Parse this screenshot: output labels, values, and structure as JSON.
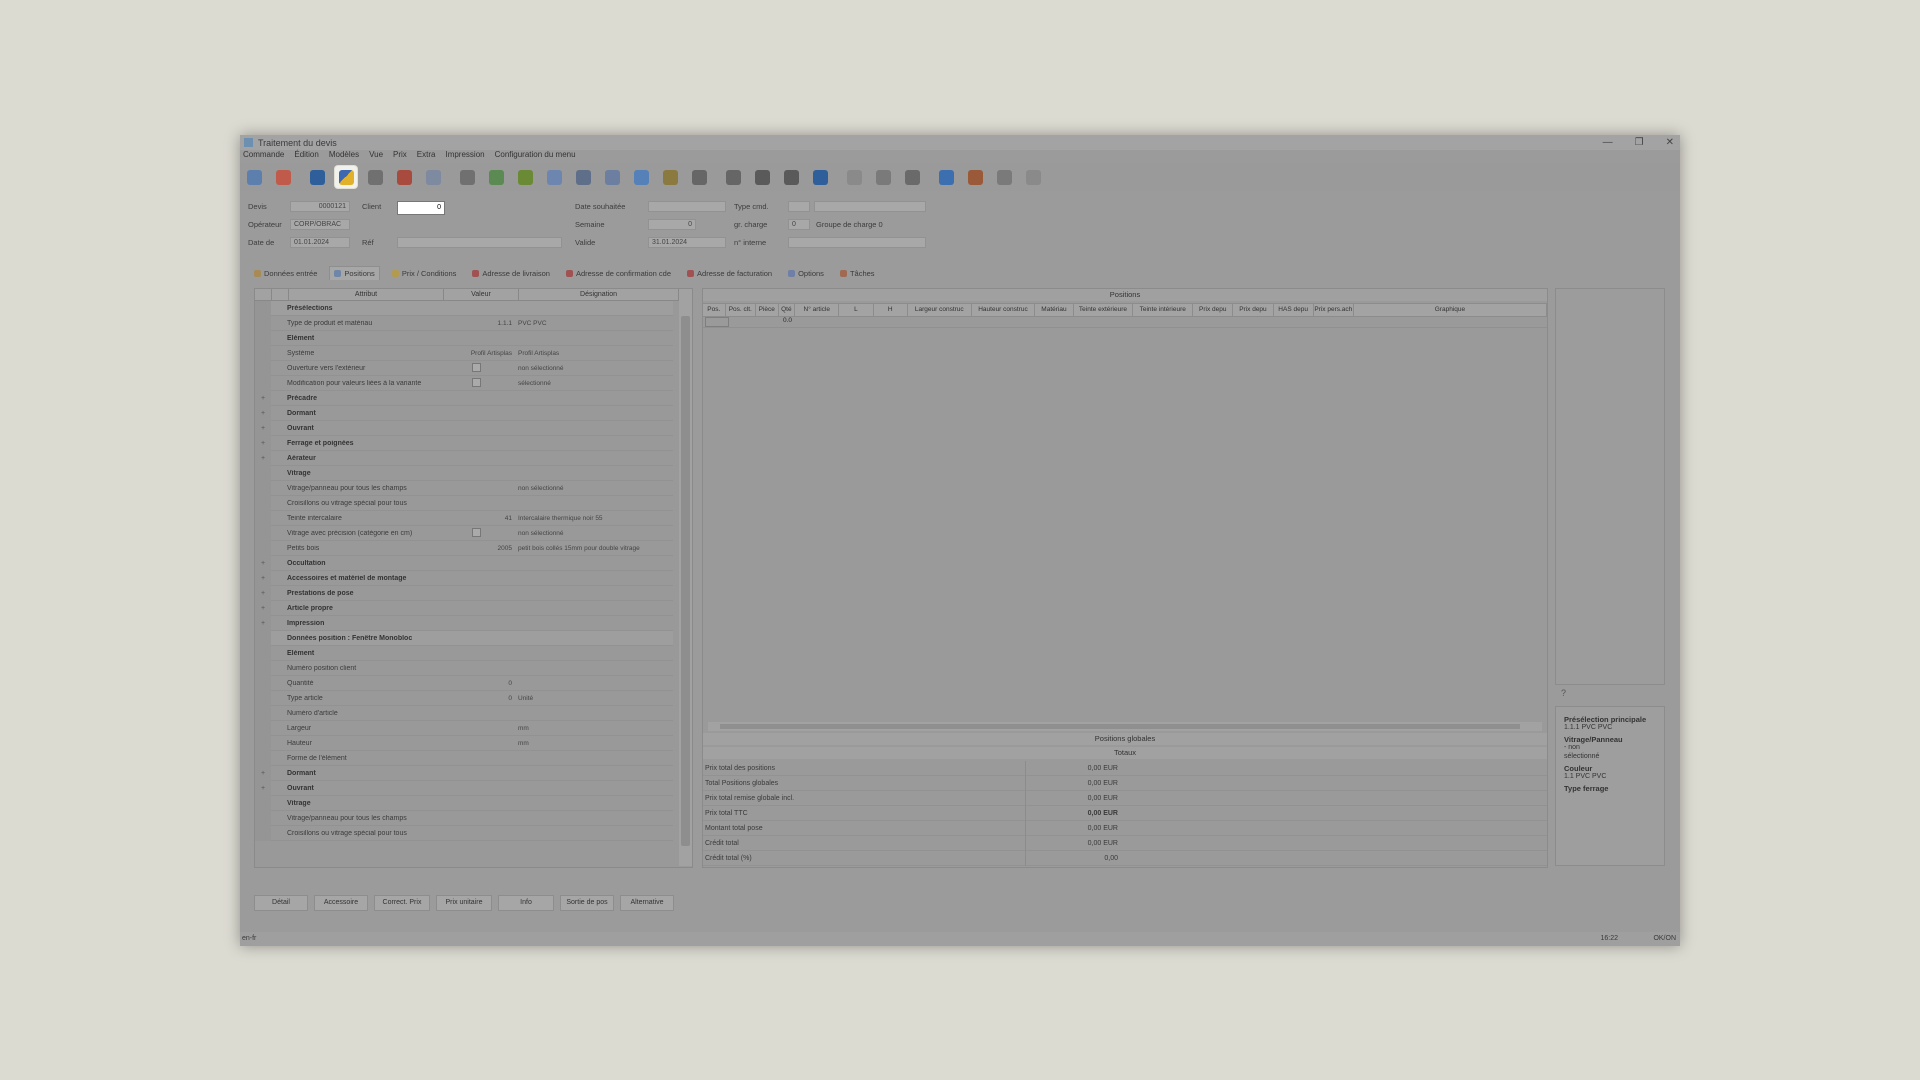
{
  "window": {
    "title": "Traitement du devis"
  },
  "window_controls": {
    "minimize": "—",
    "maximize": "❐",
    "close": "✕"
  },
  "menu": [
    "Commande",
    "Édition",
    "Modèles",
    "Vue",
    "Prix",
    "Extra",
    "Impression",
    "Configuration du menu"
  ],
  "toolbar_icons": [
    "home-icon",
    "stop-icon",
    "save-icon",
    "user-tools-icon",
    "search-icon",
    "refresh-icon",
    "document-icon",
    "print-icon",
    "color-icon",
    "hammer-icon",
    "table-icon",
    "split-icon",
    "arrow-left-icon",
    "arrow-right-icon",
    "level-icon",
    "disk-icon",
    "disk2-icon",
    "calc-icon",
    "calc2-icon",
    "pencil-icon",
    "hand-icon",
    "undo-icon",
    "info-icon",
    "sync-icon",
    "pin-icon",
    "filter-icon",
    "clipboard-icon"
  ],
  "header": {
    "devis_label": "Devis",
    "devis_value": "0000121",
    "client_label": "Client",
    "client_value": "0",
    "operateur_label": "Opérateur",
    "operateur_value": "CORP/OBRAC",
    "date_label": "Date de",
    "date_value": "01.01.2024",
    "ref_label": "Réf",
    "date_souhaitee_label": "Date souhaitée",
    "semaine_label": "Semaine",
    "semaine_value": "0",
    "valide_label": "Valide",
    "valide_value": "31.01.2024",
    "type_cmd_label": "Type cmd.",
    "gr_charge_label": "gr. charge",
    "gr_charge_value": "0",
    "gr_charge_desc": "Groupe de charge 0",
    "n_interne_label": "n° interne"
  },
  "tabs": [
    {
      "label": "Données entrée",
      "color": "#a88a55"
    },
    {
      "label": "Positions",
      "color": "#6f86a8",
      "active": true
    },
    {
      "label": "Prix / Conditions",
      "color": "#b39a4e"
    },
    {
      "label": "Adresse de livraison",
      "color": "#a05252"
    },
    {
      "label": "Adresse de confirmation cde",
      "color": "#a05252"
    },
    {
      "label": "Adresse de facturation",
      "color": "#a05252"
    },
    {
      "label": "Options",
      "color": "#6f7fa8"
    },
    {
      "label": "Tâches",
      "color": "#a06a52"
    }
  ],
  "attributes": {
    "headers": [
      "Attribut",
      "Valeur",
      "Désignation"
    ],
    "rows": [
      {
        "g": "",
        "attr": "Présélections",
        "val": "",
        "desc": "",
        "type": "sec"
      },
      {
        "g": "",
        "attr": "Type de produit et matériau",
        "val": "1.1.1",
        "desc": "PVC PVC"
      },
      {
        "g": "",
        "attr": "Élément",
        "val": "",
        "desc": "",
        "type": "grp"
      },
      {
        "g": "",
        "attr": "Système",
        "val": "Profil Artisplas",
        "desc": "Profil Artisplas"
      },
      {
        "g": "",
        "attr": "Ouverture vers l'extérieur",
        "val": "",
        "desc": "non sélectionné",
        "chk": true
      },
      {
        "g": "",
        "attr": "Modification pour valeurs liées à la variante",
        "val": "",
        "desc": "sélectionné",
        "chk": true
      },
      {
        "g": "+",
        "attr": "Précadre",
        "val": "",
        "desc": "",
        "type": "grp"
      },
      {
        "g": "+",
        "attr": "Dormant",
        "val": "",
        "desc": "",
        "type": "grp"
      },
      {
        "g": "+",
        "attr": "Ouvrant",
        "val": "",
        "desc": "",
        "type": "grp"
      },
      {
        "g": "+",
        "attr": "Ferrage et poignées",
        "val": "",
        "desc": "",
        "type": "grp"
      },
      {
        "g": "+",
        "attr": "Aérateur",
        "val": "",
        "desc": "",
        "type": "grp"
      },
      {
        "g": "",
        "attr": "Vitrage",
        "val": "",
        "desc": "",
        "type": "grp"
      },
      {
        "g": "",
        "attr": "Vitrage/panneau pour tous les champs",
        "val": "",
        "desc": "non sélectionné"
      },
      {
        "g": "",
        "attr": "Croisillons ou vitrage spécial pour tous",
        "val": "",
        "desc": ""
      },
      {
        "g": "",
        "attr": "Teinte intercalaire",
        "val": "41",
        "desc": "Intercalaire thermique noir 55"
      },
      {
        "g": "",
        "attr": "Vitrage avec précision (catégorie en cm)",
        "val": "",
        "desc": "non sélectionné",
        "chk": true
      },
      {
        "g": "",
        "attr": "Petits bois",
        "val": "2005",
        "desc": "petit bois collés 15mm pour double vitrage"
      },
      {
        "g": "+",
        "attr": "Occultation",
        "val": "",
        "desc": "",
        "type": "grp"
      },
      {
        "g": "+",
        "attr": "Accessoires et matériel de montage",
        "val": "",
        "desc": "",
        "type": "grp"
      },
      {
        "g": "+",
        "attr": "Prestations de pose",
        "val": "",
        "desc": "",
        "type": "grp"
      },
      {
        "g": "+",
        "attr": "Article propre",
        "val": "",
        "desc": "",
        "type": "grp"
      },
      {
        "g": "+",
        "attr": "Impression",
        "val": "",
        "desc": "",
        "type": "grp"
      },
      {
        "g": "",
        "attr": "Données position : Fenêtre Monobloc",
        "val": "",
        "desc": "",
        "type": "sec"
      },
      {
        "g": "",
        "attr": "Élément",
        "val": "",
        "desc": "",
        "type": "grp"
      },
      {
        "g": "",
        "attr": "Numéro position client",
        "val": "",
        "desc": ""
      },
      {
        "g": "",
        "attr": "Quantité",
        "val": "0",
        "desc": ""
      },
      {
        "g": "",
        "attr": "Type article",
        "val": "0",
        "desc": "Unité"
      },
      {
        "g": "",
        "attr": "Numéro d'article",
        "val": "",
        "desc": ""
      },
      {
        "g": "",
        "attr": "Largeur",
        "val": "",
        "desc": "mm"
      },
      {
        "g": "",
        "attr": "Hauteur",
        "val": "",
        "desc": "mm"
      },
      {
        "g": "",
        "attr": "Forme de l'élément",
        "val": "",
        "desc": ""
      },
      {
        "g": "+",
        "attr": "Dormant",
        "val": "",
        "desc": "",
        "type": "grp"
      },
      {
        "g": "+",
        "attr": "Ouvrant",
        "val": "",
        "desc": "",
        "type": "grp"
      },
      {
        "g": "",
        "attr": "Vitrage",
        "val": "",
        "desc": "",
        "type": "grp"
      },
      {
        "g": "",
        "attr": "Vitrage/panneau pour tous les champs",
        "val": "",
        "desc": ""
      },
      {
        "g": "",
        "attr": "Croisillons ou vitrage spécial pour tous",
        "val": "",
        "desc": ""
      }
    ]
  },
  "positions": {
    "title": "Positions",
    "columns": [
      "Pos.",
      "Pos. clt.",
      "Pièce",
      "Qté",
      "N° article",
      "L",
      "H",
      "Largeur construc",
      "Hauteur construc",
      "Matériau",
      "Teinte extérieure",
      "Teinte intérieure",
      "Prix depu",
      "Prix depu",
      "HAS depu",
      "Prix pers.ach",
      "Graphique"
    ],
    "first_row_value": "0.0",
    "global_positions_label": "Positions globales",
    "totals_label": "Totaux",
    "totals": [
      {
        "label": "Prix total des positions",
        "value": "0,00 EUR"
      },
      {
        "label": "Total Positions globales",
        "value": "0,00 EUR"
      },
      {
        "label": "Prix total remise globale incl.",
        "value": "0,00 EUR"
      },
      {
        "label": "Prix total TTC",
        "value": "0,00 EUR"
      },
      {
        "label": "Montant total pose",
        "value": "0,00 EUR"
      },
      {
        "label": "Crédit total",
        "value": "0,00 EUR"
      },
      {
        "label": "Crédit total (%)",
        "value": "0,00"
      }
    ]
  },
  "preview": {
    "question_mark": "?",
    "info": [
      {
        "title": "Présélection principale",
        "lines": [
          "1.1.1  PVC PVC"
        ]
      },
      {
        "title": "Vitrage/Panneau",
        "lines": [
          "-  non",
          "sélectionné"
        ]
      },
      {
        "title": "Couleur",
        "lines": [
          "1.1  PVC PVC"
        ]
      },
      {
        "title": "Type ferrage",
        "lines": []
      }
    ]
  },
  "bottom_buttons": [
    "Détail",
    "Accessoire",
    "Correct. Prix",
    "Prix unitaire",
    "Info",
    "Sortie de pos",
    "Alternative"
  ],
  "status": {
    "left": "en-fr",
    "right1": "16:22",
    "right2": "OK/ON"
  }
}
